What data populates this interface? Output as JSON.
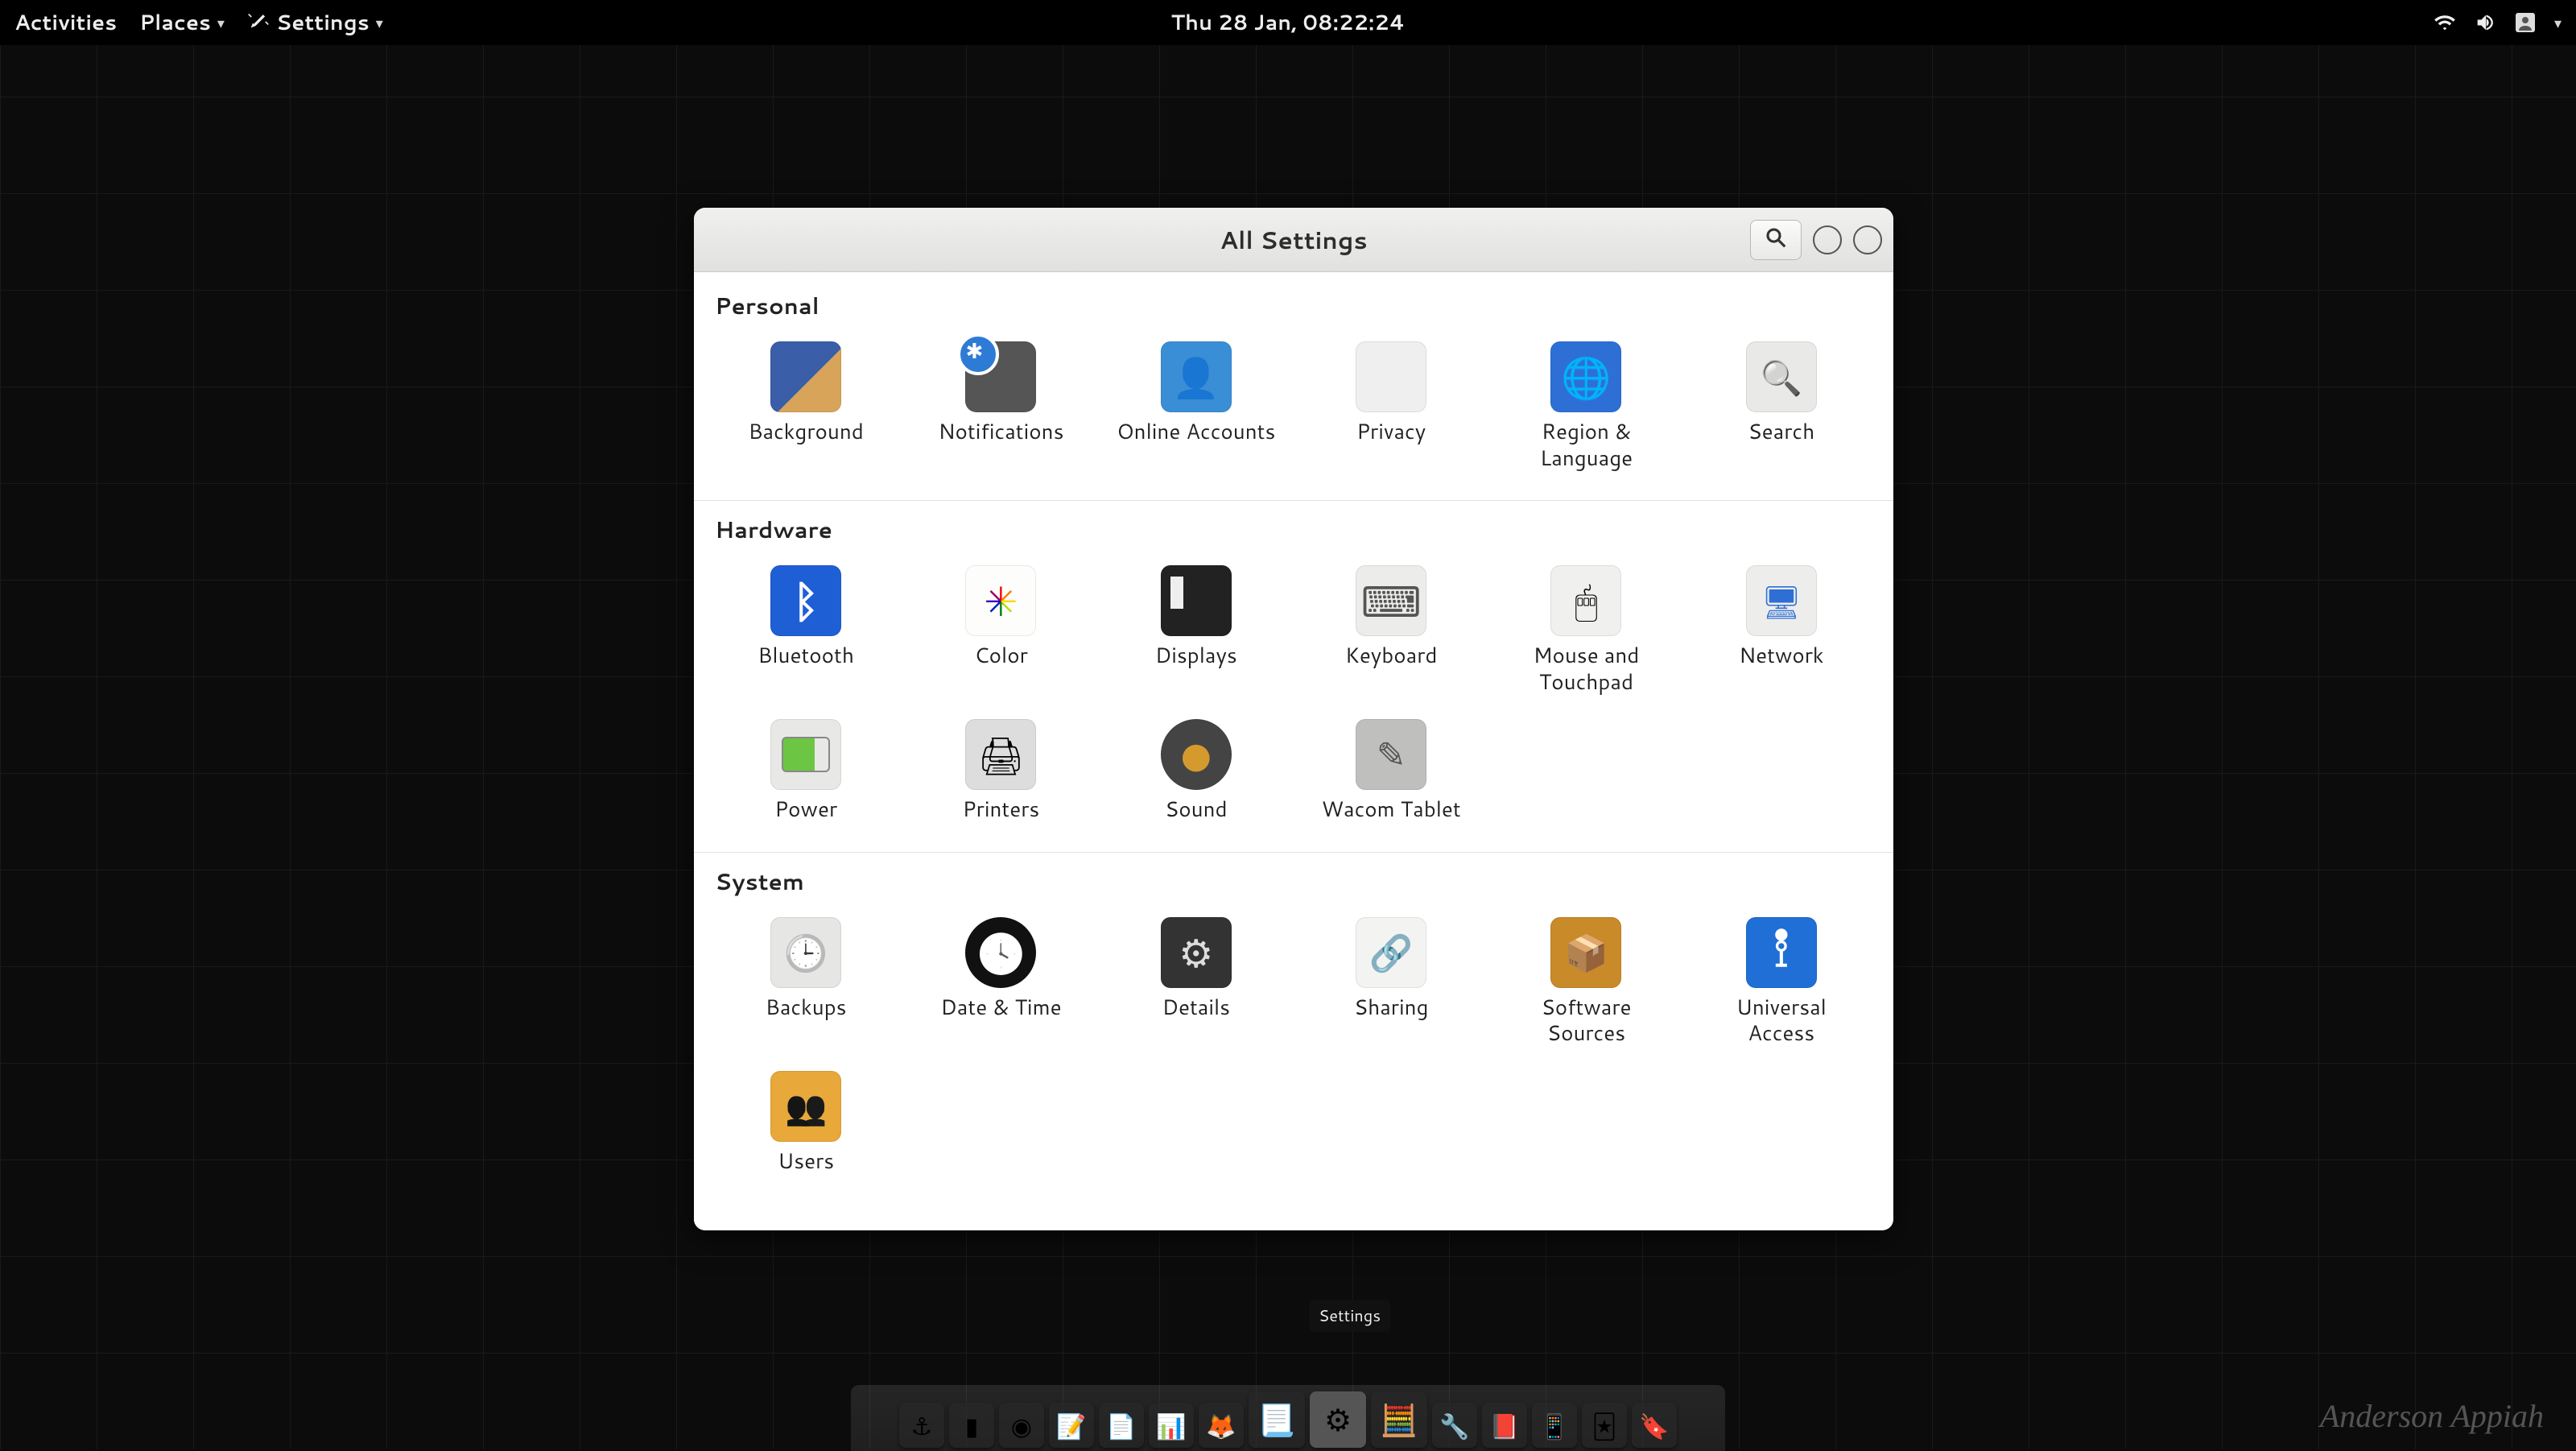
{
  "panel": {
    "activities": "Activities",
    "places": "Places",
    "app_menu": "Settings",
    "clock": "Thu 28 Jan, 08:22:24"
  },
  "window": {
    "title": "All Settings"
  },
  "sections": {
    "personal": {
      "title": "Personal",
      "items": [
        {
          "id": "background",
          "label": "Background"
        },
        {
          "id": "notifications",
          "label": "Notifications"
        },
        {
          "id": "online-accounts",
          "label": "Online Accounts"
        },
        {
          "id": "privacy",
          "label": "Privacy"
        },
        {
          "id": "region-language",
          "label": "Region & Language"
        },
        {
          "id": "search",
          "label": "Search"
        }
      ]
    },
    "hardware": {
      "title": "Hardware",
      "items": [
        {
          "id": "bluetooth",
          "label": "Bluetooth"
        },
        {
          "id": "color",
          "label": "Color"
        },
        {
          "id": "displays",
          "label": "Displays"
        },
        {
          "id": "keyboard",
          "label": "Keyboard"
        },
        {
          "id": "mouse-touchpad",
          "label": "Mouse and Touchpad"
        },
        {
          "id": "network",
          "label": "Network"
        },
        {
          "id": "power",
          "label": "Power"
        },
        {
          "id": "printers",
          "label": "Printers"
        },
        {
          "id": "sound",
          "label": "Sound"
        },
        {
          "id": "wacom",
          "label": "Wacom Tablet"
        }
      ]
    },
    "system": {
      "title": "System",
      "items": [
        {
          "id": "backups",
          "label": "Backups"
        },
        {
          "id": "date-time",
          "label": "Date & Time"
        },
        {
          "id": "details",
          "label": "Details"
        },
        {
          "id": "sharing",
          "label": "Sharing"
        },
        {
          "id": "software-sources",
          "label": "Software Sources"
        },
        {
          "id": "universal-access",
          "label": "Universal Access"
        },
        {
          "id": "users",
          "label": "Users"
        }
      ]
    }
  },
  "dock": {
    "tooltip": "Settings",
    "items": [
      {
        "id": "anchor",
        "glyph": "⚓",
        "big": false
      },
      {
        "id": "terminal",
        "glyph": "▮",
        "big": false
      },
      {
        "id": "vlc",
        "glyph": "◉",
        "big": false
      },
      {
        "id": "notes",
        "glyph": "📝",
        "big": false
      },
      {
        "id": "doc",
        "glyph": "📄",
        "big": false
      },
      {
        "id": "slides",
        "glyph": "📊",
        "big": false
      },
      {
        "id": "firefox",
        "glyph": "🦊",
        "big": false
      },
      {
        "id": "text-editor",
        "glyph": "📃",
        "big": true
      },
      {
        "id": "settings",
        "glyph": "⚙",
        "big": true,
        "active": true
      },
      {
        "id": "calculator",
        "glyph": "🧮",
        "big": true
      },
      {
        "id": "tool1",
        "glyph": "🔧",
        "big": false
      },
      {
        "id": "tool2",
        "glyph": "📕",
        "big": false
      },
      {
        "id": "tool3",
        "glyph": "📱",
        "big": false
      },
      {
        "id": "tool4",
        "glyph": "🃏",
        "big": false
      },
      {
        "id": "tool5",
        "glyph": "🔖",
        "big": false
      }
    ]
  },
  "signature": "Anderson Appiah"
}
